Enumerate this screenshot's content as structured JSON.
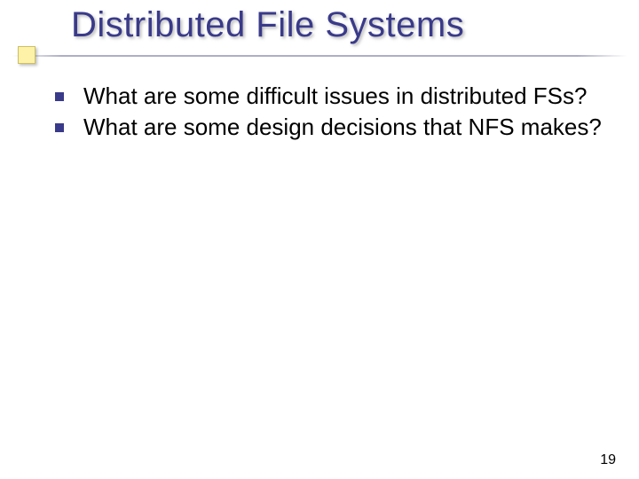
{
  "slide": {
    "title": "Distributed File Systems",
    "bullets": [
      "What are some difficult issues in distributed FSs?",
      "What are some design decisions that NFS makes?"
    ],
    "page_number": "19"
  }
}
